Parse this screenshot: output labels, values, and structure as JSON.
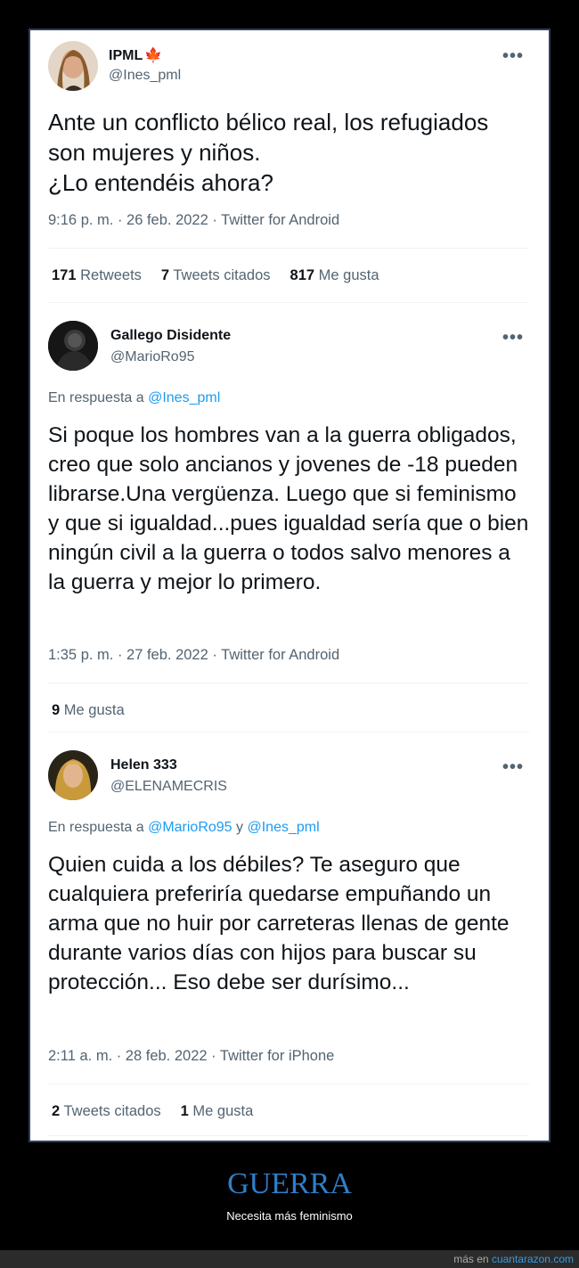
{
  "tweets": [
    {
      "name": "IPML",
      "flag": "🍁",
      "handle": "@Ines_pml",
      "text": "Ante un conflicto bélico real, los refugiados son mujeres y niños.\n¿Lo entendéis ahora?",
      "meta": "9:16 p. m. · 26 feb. 2022 · Twitter for Android",
      "stats": [
        {
          "count": "171",
          "label": "Retweets"
        },
        {
          "count": "7",
          "label": "Tweets citados"
        },
        {
          "count": "817",
          "label": "Me gusta"
        }
      ]
    },
    {
      "name": "Gallego Disidente",
      "handle": "@MarioRo95",
      "reply_prefix": "En respuesta a",
      "reply_mentions": [
        "@Ines_pml"
      ],
      "text": "Si poque los hombres van a la guerra obligados, creo que solo ancianos y jovenes de -18 pueden librarse.Una vergüenza. Luego que si feminismo y que si igualdad...pues igualdad sería que o bien ningún civil a la guerra o todos salvo menores a la guerra y mejor lo primero.",
      "meta": "1:35 p. m. · 27 feb. 2022 · Twitter for Android",
      "stats": [
        {
          "count": "9",
          "label": "Me gusta"
        }
      ]
    },
    {
      "name": "Helen 333",
      "handle": "@ELENAMECRIS",
      "reply_prefix": "En respuesta a",
      "reply_mentions": [
        "@MarioRo95",
        "@Ines_pml"
      ],
      "reply_joiner": "y",
      "text": "Quien cuida a los débiles? Te aseguro que cualquiera preferiría quedarse empuñando un arma que no huir por carreteras llenas de gente durante varios días con hijos para buscar su protección... Eso debe ser durísimo...",
      "meta": "2:11 a. m. · 28 feb. 2022 · Twitter for iPhone",
      "stats": [
        {
          "count": "2",
          "label": "Tweets citados"
        },
        {
          "count": "1",
          "label": "Me gusta"
        }
      ]
    }
  ],
  "more_glyph": "•••",
  "footer": {
    "title": "GUERRA",
    "subtitle": "Necesita más feminismo",
    "more_prefix": "más en",
    "site": "cuantarazon.com"
  },
  "colors": {
    "background": "#000000",
    "link": "#1d9bf0",
    "footer_title": "#2e7fc9"
  }
}
